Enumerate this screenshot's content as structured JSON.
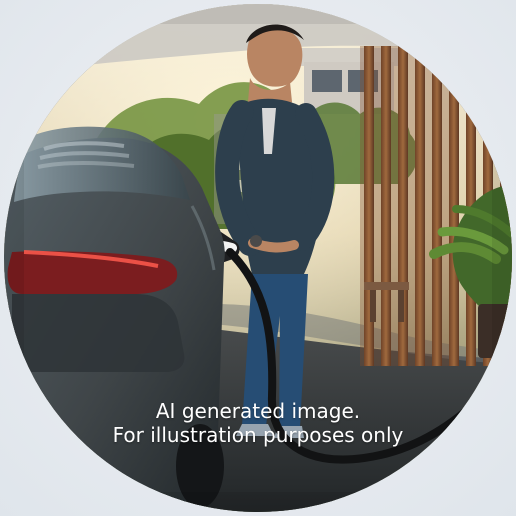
{
  "caption": {
    "line1": "AI generated image.",
    "line2": "For illustration purposes only"
  },
  "colors": {
    "page_background": "#e9edf2",
    "car_body": "#3f4548",
    "shirt": "#2d3f4d",
    "jeans": "#264d74",
    "wood": "#8a5632",
    "foliage": "#5e7c33",
    "sky_glow": "#d9c9a2",
    "caption_text": "#ffffff"
  }
}
